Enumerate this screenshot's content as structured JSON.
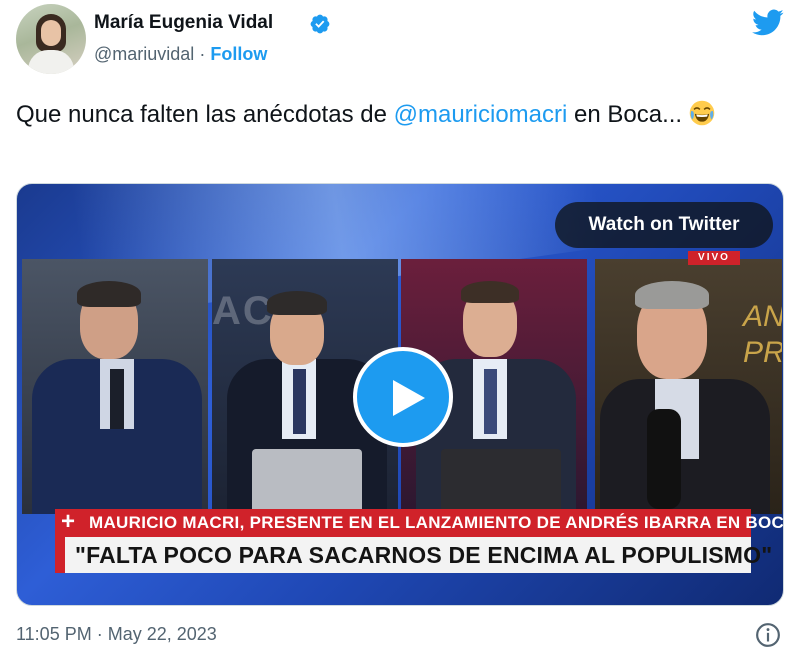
{
  "author": {
    "name": "María Eugenia Vidal",
    "handle": "@mariuvidal",
    "separator": "·",
    "follow_label": "Follow",
    "verified_icon": "verified-badge-icon",
    "avatar_icon": "avatar"
  },
  "brand": {
    "icon": "twitter-bird-icon",
    "color": "#1d9bf0"
  },
  "tweet": {
    "text_before": "Que nunca falten las anécdotas de ",
    "mention": "@mauriciomacri",
    "text_after": " en Boca... ",
    "emoji": "face-with-tears-of-joy"
  },
  "media": {
    "watch_label": "Watch on Twitter",
    "live_badge": "VIVO",
    "wall_text": "ACRI",
    "deco_text": "AN PR",
    "lower_third_headline": "MAURICIO MACRI, PRESENTE EN EL LANZAMIENTO DE ANDRÉS IBARRA EN BOCA",
    "lower_third_plus": "+",
    "lower_third_quote": "\"FALTA POCO PARA SACARNOS DE ENCIMA AL POPULISMO\"",
    "play_icon": "play-icon"
  },
  "footer": {
    "timestamp": "11:05 PM · May 22, 2023",
    "info_icon": "info-icon"
  },
  "colors": {
    "accent": "#1d9bf0",
    "text_primary": "#0f1419",
    "text_secondary": "#536471",
    "news_red": "#d0222a"
  }
}
